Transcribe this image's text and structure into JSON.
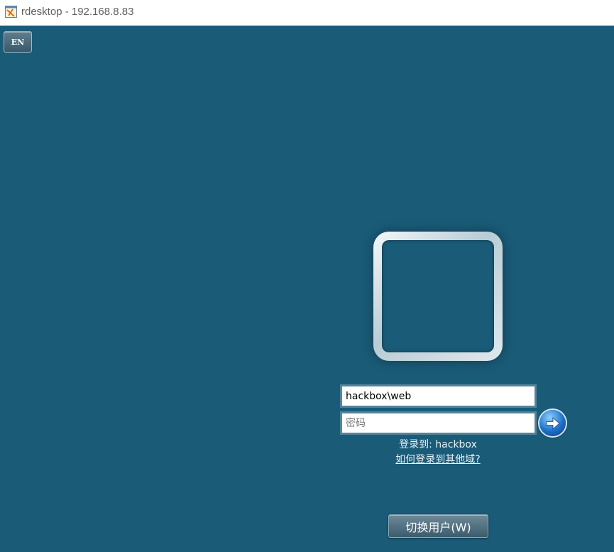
{
  "window": {
    "title": "rdesktop - 192.168.8.83",
    "icon": "rdesktop-app-icon"
  },
  "language_indicator": {
    "label": "EN"
  },
  "login": {
    "avatar": "user-tile-frame",
    "username_value": "hackbox\\web",
    "password_placeholder": "密码",
    "submit_icon": "arrow-right-icon",
    "domain_text": "登录到: hackbox",
    "other_domain_link": "如何登录到其他域?"
  },
  "switch_user": {
    "label": "切换用户(W)"
  },
  "colors": {
    "desktop_background": "#1a5b78",
    "submit_button": "#1d6fc9"
  }
}
